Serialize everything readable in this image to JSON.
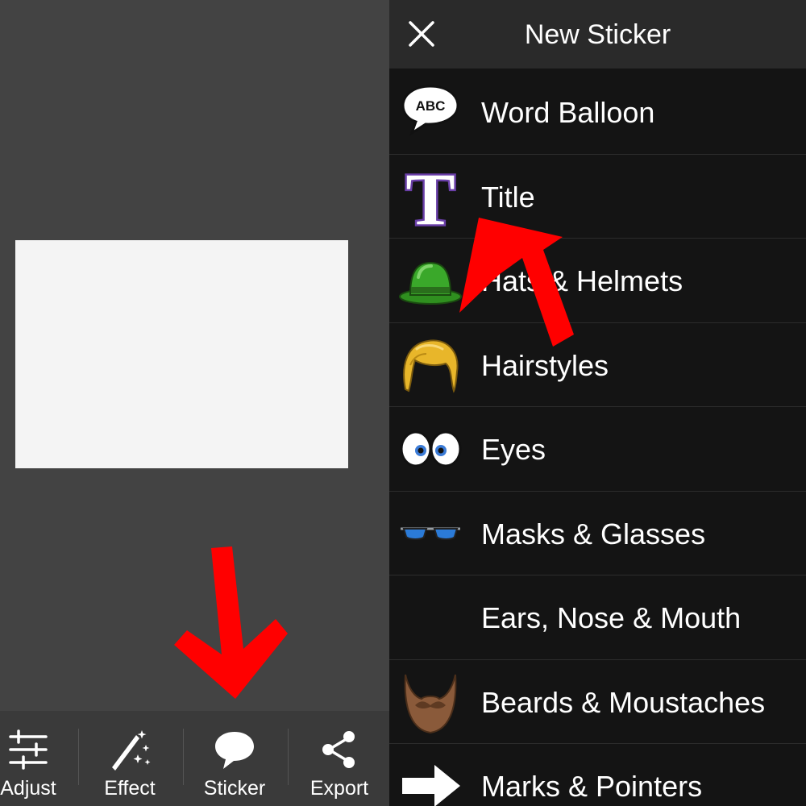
{
  "editor": {
    "toolbar": [
      {
        "label": "Adjust",
        "icon": "sliders-icon"
      },
      {
        "label": "Effect",
        "icon": "magic-wand-icon"
      },
      {
        "label": "Sticker",
        "icon": "speech-bubble-icon"
      },
      {
        "label": "Export",
        "icon": "share-icon"
      }
    ]
  },
  "sticker_panel": {
    "title": "New Sticker",
    "close_icon": "close-icon",
    "categories": [
      {
        "label": "Word Balloon",
        "icon": "word-balloon-icon",
        "icon_text": "ABC"
      },
      {
        "label": "Title",
        "icon": "title-letter-icon",
        "icon_text": "T"
      },
      {
        "label": "Hats & Helmets",
        "icon": "bowler-hat-icon"
      },
      {
        "label": "Hairstyles",
        "icon": "hairstyle-icon"
      },
      {
        "label": "Eyes",
        "icon": "eyes-icon"
      },
      {
        "label": "Masks & Glasses",
        "icon": "glasses-icon"
      },
      {
        "label": "Ears, Nose & Mouth",
        "icon": "none"
      },
      {
        "label": "Beards & Moustaches",
        "icon": "beard-icon"
      },
      {
        "label": "Marks & Pointers",
        "icon": "arrow-pointer-icon"
      }
    ]
  },
  "colors": {
    "annotation_arrow": "#ff0000",
    "panel_background": "#141414",
    "header_background": "#2a2a2a",
    "editor_background": "#434343"
  }
}
